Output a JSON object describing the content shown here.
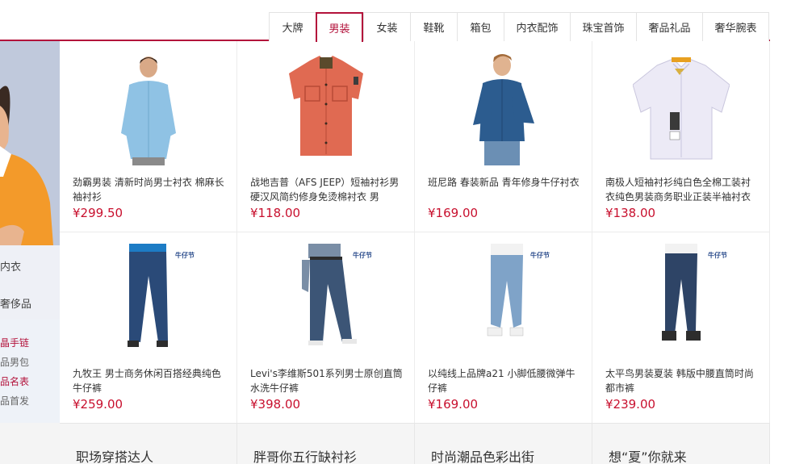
{
  "tabs": [
    {
      "label": "大牌",
      "active": false
    },
    {
      "label": "男装",
      "active": true
    },
    {
      "label": "女装",
      "active": false
    },
    {
      "label": "鞋靴",
      "active": false
    },
    {
      "label": "箱包",
      "active": false
    },
    {
      "label": "内衣配饰",
      "active": false
    },
    {
      "label": "珠宝首饰",
      "active": false
    },
    {
      "label": "奢品礼品",
      "active": false
    },
    {
      "label": "奢华腕表",
      "active": false
    }
  ],
  "accent_color": "#b3123b",
  "price_color": "#c8102e",
  "left_panel": {
    "categories": [
      "内衣",
      "奢侈品"
    ],
    "links": [
      "晶手链",
      "品男包",
      "品名表",
      "品首发"
    ]
  },
  "brand_tag": "牛仔节",
  "products": [
    {
      "title": "劲霸男装 清新时尚男士衬衣 棉麻长袖衬衫",
      "price": "¥299.50",
      "icon": "light-blue-shirt-model-image"
    },
    {
      "title": "战地吉普（AFS JEEP）短袖衬衫男硬汉风简约修身免烫棉衬衣 男",
      "price": "¥118.00",
      "icon": "red-short-sleeve-shirt-image"
    },
    {
      "title": "班尼路 春装新品 青年修身牛仔衬衣",
      "price": "¥169.00",
      "icon": "denim-shirt-model-image"
    },
    {
      "title": "南极人短袖衬衫纯白色全棉工装衬衣纯色男装商务职业正装半袖衬衣",
      "price": "¥138.00",
      "icon": "white-shirt-image"
    },
    {
      "title": "九牧王 男士商务休闲百搭经典纯色牛仔裤",
      "price": "¥259.00",
      "icon": "dark-jeans-image"
    },
    {
      "title": "Levi's李维斯501系列男士原创直筒水洗牛仔裤",
      "price": "¥398.00",
      "icon": "levis-jeans-image"
    },
    {
      "title": "以纯线上品牌a21 小脚低腰微弹牛仔裤",
      "price": "¥169.00",
      "icon": "light-jeans-image"
    },
    {
      "title": "太平鸟男装夏装 韩版中腰直筒时尚都市裤",
      "price": "¥239.00",
      "icon": "slim-jeans-image"
    }
  ],
  "bottom_items": [
    "职场穿搭达人",
    "胖哥你五行缺衬衫",
    "时尚潮品色彩出街",
    "想“夏”你就来"
  ]
}
